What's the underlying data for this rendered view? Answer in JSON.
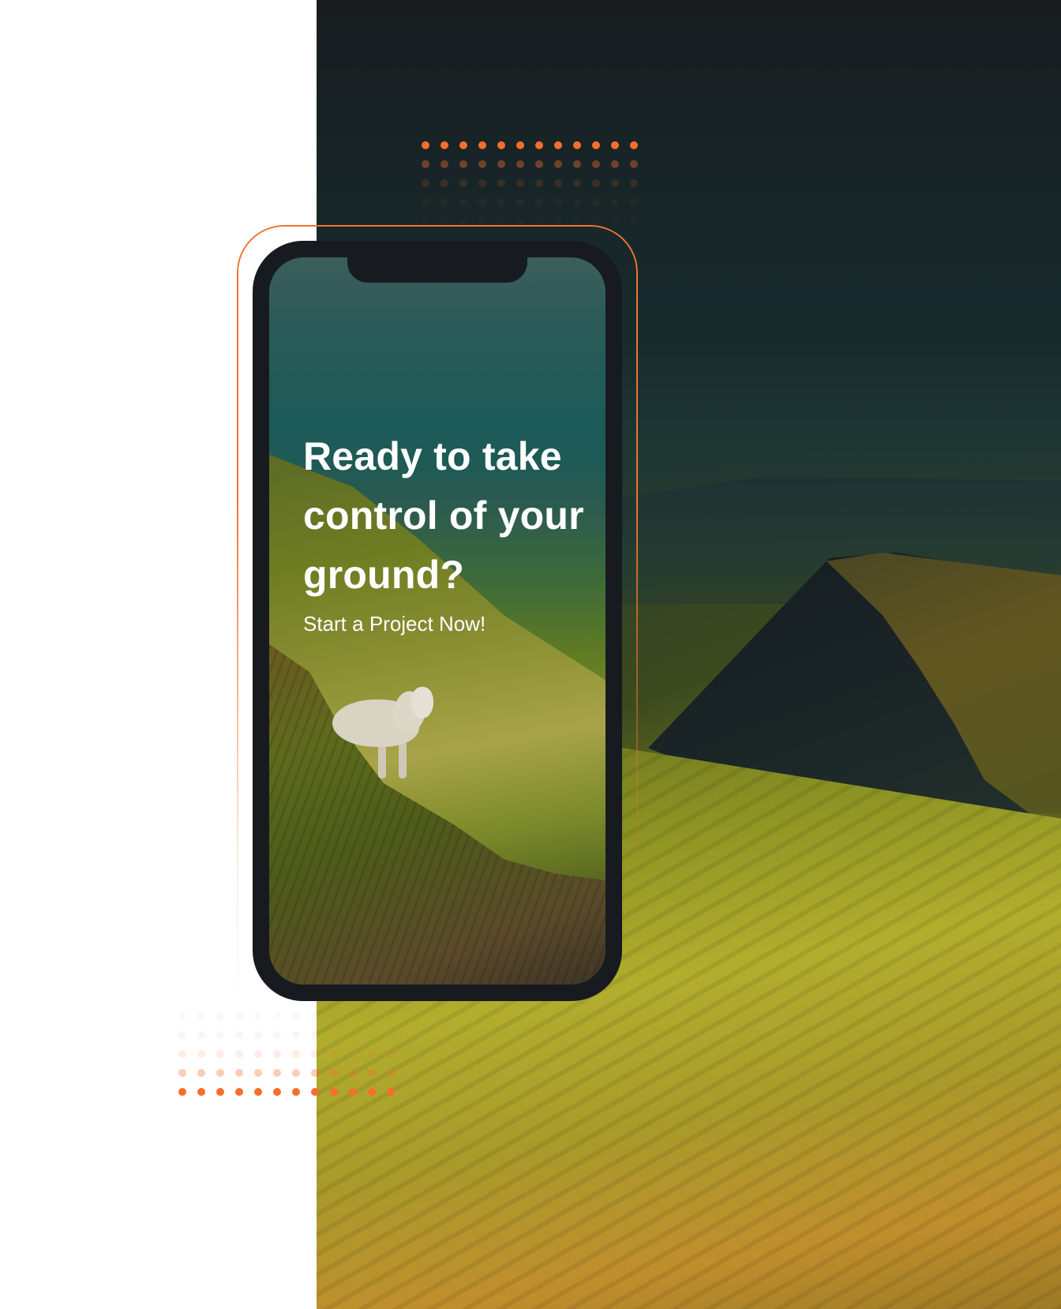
{
  "hero": {
    "headline": "Ready to take control of your ground?",
    "cta_text": "Start a Project Now!"
  },
  "colors": {
    "accent": "#f46f2e",
    "phone_frame": "#171b1f",
    "panel_dark": "#181c1f",
    "text": "#ffffff"
  },
  "decorations": {
    "dot_grid_top": {
      "rows": 5,
      "cols": 12
    },
    "dot_grid_bottom": {
      "rows": 5,
      "cols": 12
    }
  },
  "images": {
    "background": "landscape-hills",
    "phone_screen": "sheep-on-hillside"
  }
}
